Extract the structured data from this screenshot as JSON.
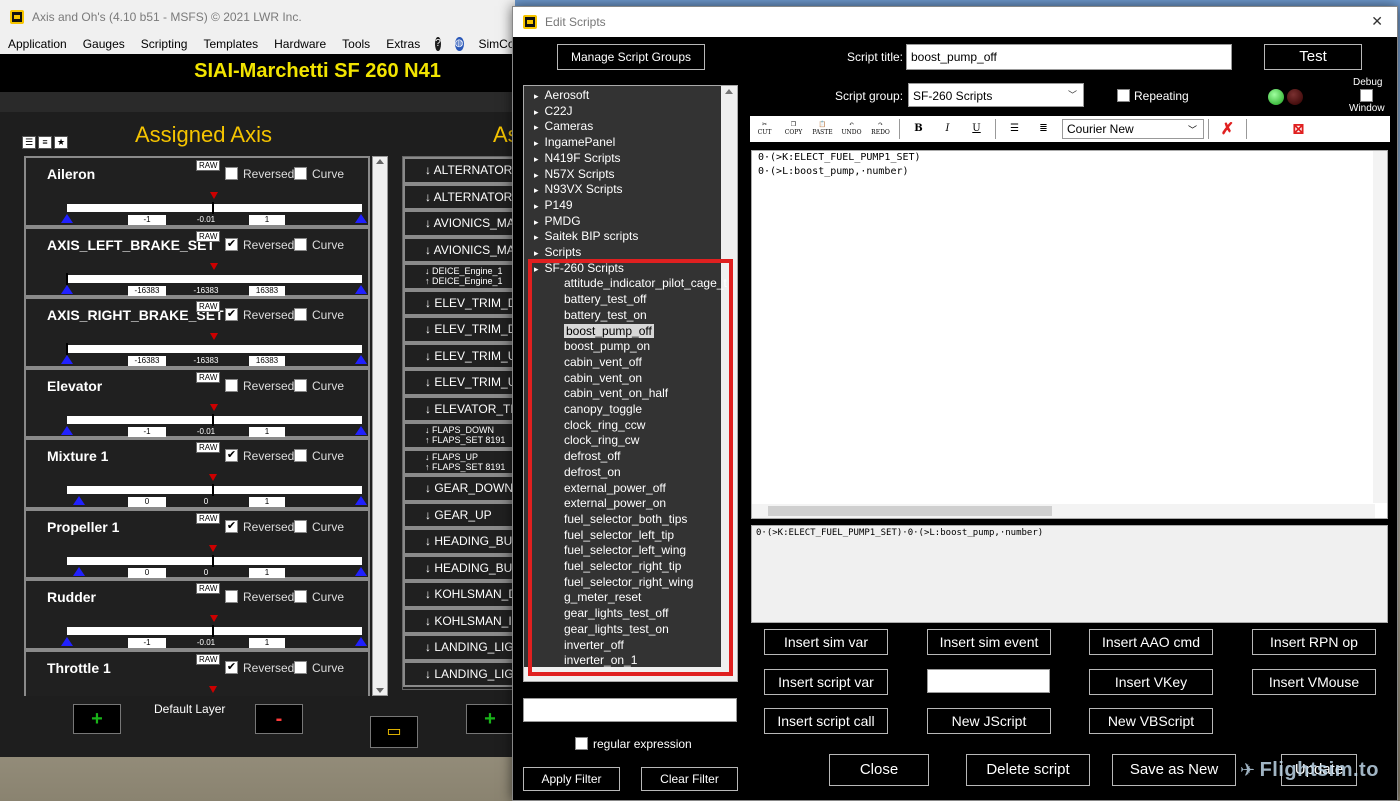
{
  "back_window": {
    "title": "Axis and Oh's (4.10 b51 - MSFS) © 2021 LWR Inc.",
    "menu": [
      "Application",
      "Gauges",
      "Scripting",
      "Templates",
      "Hardware",
      "Tools",
      "Extras",
      "SimCon"
    ],
    "aircraft_title": "SIAI-Marchetti SF 260 N41",
    "assigned_axis_title": "Assigned Axis",
    "assigned_right_title": "As",
    "reversed_label": "Reversed",
    "curve_label": "Curve",
    "raw_label": "RAW",
    "axes": [
      {
        "name": "Aileron",
        "reversed": false,
        "curve": false,
        "min": "-1",
        "cur": "-0.01",
        "max": "1"
      },
      {
        "name": "AXIS_LEFT_BRAKE_SET",
        "reversed": true,
        "curve": false,
        "min": "-16383",
        "cur": "-16383",
        "max": "16383"
      },
      {
        "name": "AXIS_RIGHT_BRAKE_SET",
        "reversed": true,
        "curve": false,
        "min": "-16383",
        "cur": "-16383",
        "max": "16383"
      },
      {
        "name": "Elevator",
        "reversed": false,
        "curve": false,
        "min": "-1",
        "cur": "-0.01",
        "max": "1"
      },
      {
        "name": "Mixture 1",
        "reversed": true,
        "curve": false,
        "min": "0",
        "cur": "0",
        "max": "1"
      },
      {
        "name": "Propeller 1",
        "reversed": true,
        "curve": false,
        "min": "0",
        "cur": "0",
        "max": "1"
      },
      {
        "name": "Rudder",
        "reversed": false,
        "curve": false,
        "min": "-1",
        "cur": "-0.01",
        "max": "1"
      },
      {
        "name": "Throttle 1",
        "reversed": true,
        "curve": false,
        "min": "",
        "cur": "",
        "max": ""
      }
    ],
    "events": [
      "↓ ALTERNATOR_S",
      "↓ ALTERNATOR_S",
      "↓ AVIONICS_MAS",
      "↓ AVIONICS_MAS",
      "↓ DEICE_Engine_1|↑ DEICE_Engine_1",
      "↓ ELEV_TRIM_DN",
      "↓ ELEV_TRIM_DN",
      "↓ ELEV_TRIM_UP",
      "↓ ELEV_TRIM_UP",
      "↓ ELEVATOR_TRIM",
      "↓ FLAPS_DOWN|↑ FLAPS_SET 8191",
      "↓ FLAPS_UP|↑ FLAPS_SET 8191",
      "↓ GEAR_DOWN",
      "↓ GEAR_UP",
      "↓ HEADING_BUG",
      "↓ HEADING_BUG",
      "↓ KOHLSMAN_DI",
      "↓ KOHLSMAN_IN",
      "↓ LANDING_LIGH",
      "↓ LANDING_LIGH"
    ],
    "default_layer": "Default Layer",
    "plus": "+",
    "minus": "-"
  },
  "edit_scripts": {
    "title": "Edit Scripts",
    "manage_groups": "Manage Script Groups",
    "script_title_label": "Script title:",
    "script_title_value": "boost_pump_off",
    "test": "Test",
    "script_group_label": "Script group:",
    "script_group_value": "SF-260 Scripts",
    "repeating": "Repeating",
    "debug_label": "Debug",
    "window_label": "Window",
    "font": "Courier New",
    "toolbar": {
      "cut": "CUT",
      "copy": "COPY",
      "paste": "PASTE",
      "undo": "UNDO",
      "redo": "REDO",
      "bold": "B",
      "italic": "I",
      "underline": "U"
    },
    "folders": [
      "Aerosoft",
      "C22J",
      "Cameras",
      "IngamePanel",
      "N419F Scripts",
      "N57X Scripts",
      "N93VX Scripts",
      "P149",
      "PMDG",
      "Saitek BIP scripts",
      "Scripts",
      "SF-260 Scripts"
    ],
    "scripts": [
      "attitude_indicator_pilot_cage_t",
      "battery_test_off",
      "battery_test_on",
      "boost_pump_off",
      "boost_pump_on",
      "cabin_vent_off",
      "cabin_vent_on",
      "cabin_vent_on_half",
      "canopy_toggle",
      "clock_ring_ccw",
      "clock_ring_cw",
      "defrost_off",
      "defrost_on",
      "external_power_off",
      "external_power_on",
      "fuel_selector_both_tips",
      "fuel_selector_left_tip",
      "fuel_selector_left_wing",
      "fuel_selector_right_tip",
      "fuel_selector_right_wing",
      "g_meter_reset",
      "gear_lights_test_off",
      "gear_lights_test_on",
      "inverter_off",
      "inverter_on_1"
    ],
    "selected_script": "boost_pump_off",
    "editor_lines": [
      "0·(>K:ELECT_FUEL_PUMP1_SET)",
      "0·(>L:boost_pump,·number)"
    ],
    "preview": "0·(>K:ELECT_FUEL_PUMP1_SET)·0·(>L:boost_pump,·number)",
    "insert_buttons": {
      "sim_var": "Insert sim var",
      "sim_event": "Insert sim event",
      "aao_cmd": "Insert AAO cmd",
      "rpn_op": "Insert RPN op",
      "script_var": "Insert script var",
      "vkey": "Insert VKey",
      "vmouse": "Insert VMouse",
      "script_call": "Insert script call",
      "new_jscript": "New JScript",
      "new_vbscript": "New VBScript"
    },
    "regex_label": "regular expression",
    "apply_filter": "Apply Filter",
    "clear_filter": "Clear Filter",
    "close": "Close",
    "delete": "Delete script",
    "save_as_new": "Save as New",
    "update": "Update"
  },
  "watermark": "Flightsim.to",
  "colors": {
    "accent_yellow": "#f5c400",
    "selection_box": "#e02020",
    "led_green": "#1aa01a"
  }
}
